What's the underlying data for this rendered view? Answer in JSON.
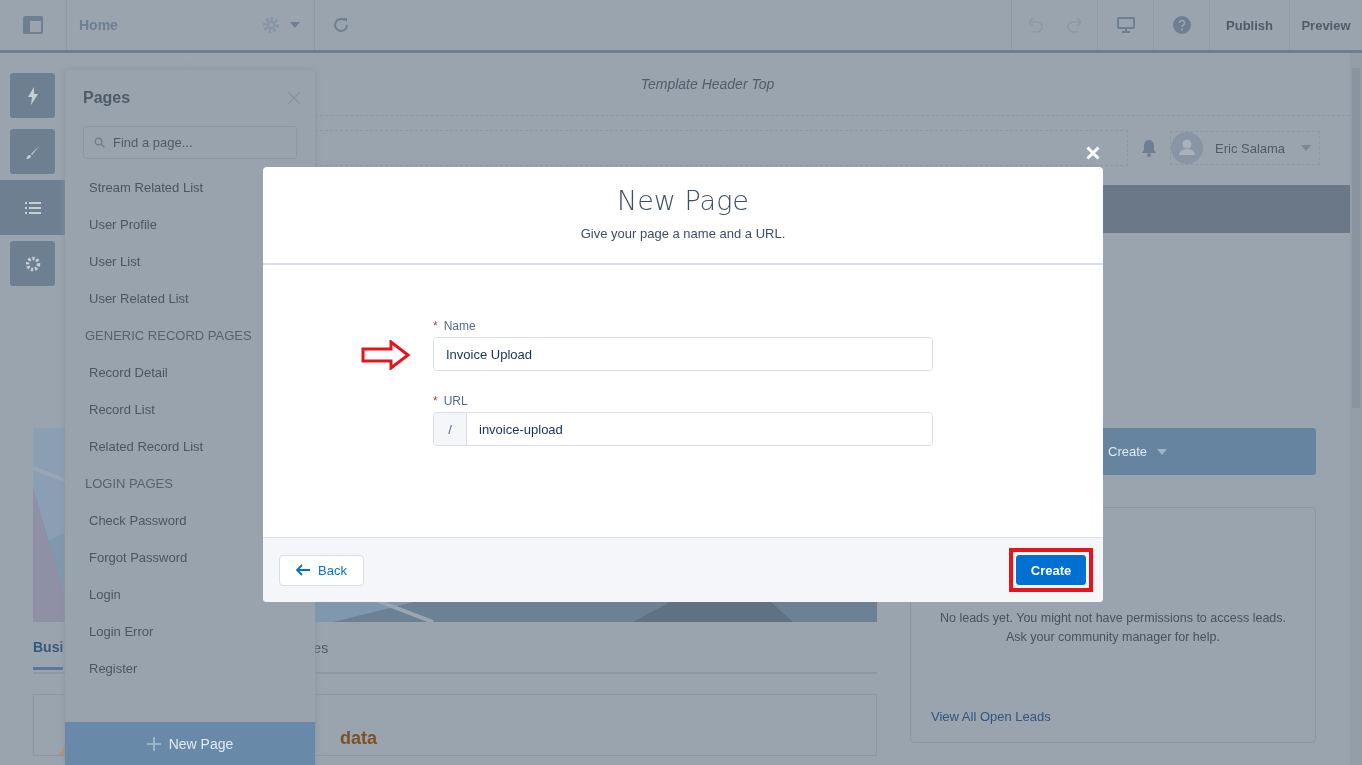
{
  "topbar": {
    "page": "Home",
    "actions": [
      "Publish",
      "Preview"
    ]
  },
  "canvas": {
    "header_region": "Template Header Top",
    "user_name": "Eric Salama",
    "create_button": "Create",
    "tabs": [
      {
        "label": "Busi",
        "selected": true
      },
      {
        "label": "es",
        "selected": false
      }
    ],
    "empty_component": "data",
    "leads_message": "No leads yet. You might not have permissions to access leads. Ask your community manager for help.",
    "leads_link": "View All Open Leads"
  },
  "pages_panel": {
    "title": "Pages",
    "search": {
      "placeholder": "Find a page..."
    },
    "groups": [
      {
        "items": [
          "Stream Related List",
          "User Profile",
          "User List",
          "User Related List"
        ]
      },
      {
        "heading": "GENERIC RECORD PAGES",
        "items": [
          "Record Detail",
          "Record List",
          "Related Record List"
        ]
      },
      {
        "heading": "LOGIN PAGES",
        "items": [
          "Check Password",
          "Forgot Password",
          "Login",
          "Login Error",
          "Register"
        ]
      }
    ],
    "new_page_button": "New Page"
  },
  "modal": {
    "title": "New Page",
    "subtitle": "Give your page a name and a URL.",
    "fields": [
      {
        "required_mark": "*",
        "label": "Name",
        "value": "Invoice Upload"
      },
      {
        "required_mark": "*",
        "label": "URL",
        "prefix": "/",
        "value": "invoice-upload"
      }
    ],
    "back_button": "Back",
    "create_button": "Create"
  }
}
